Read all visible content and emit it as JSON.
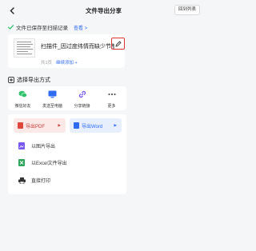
{
  "header": {
    "title": "文件导出分享",
    "return_label": "回到列表"
  },
  "saved": {
    "text": "文件已保存至扫描记录",
    "view_label": "查看 >"
  },
  "file": {
    "name": "扫描件_因过度纬情而缺少节制",
    "pages": "共1页",
    "continue_add": "继续添加 +"
  },
  "export_section": {
    "title": "选择导出方式"
  },
  "share": {
    "items": [
      {
        "label": "微信好友",
        "icon": "wechat-icon",
        "color": "#2ec26a"
      },
      {
        "label": "发送至电脑",
        "icon": "computer-icon",
        "color": "#2e6bf0"
      },
      {
        "label": "分享链接",
        "icon": "link-icon",
        "color": "#7b5af0"
      },
      {
        "label": "更多",
        "icon": "more-icon",
        "color": "#555555"
      }
    ]
  },
  "export": {
    "pdf_label": "导出PDF",
    "word_label": "导出Word",
    "options": [
      {
        "label": "以图片导出",
        "icon": "image-icon",
        "color": "#7b5af0"
      },
      {
        "label": "以Excel文件导出",
        "icon": "excel-icon",
        "color": "#2ea55b"
      },
      {
        "label": "直接打印",
        "icon": "printer-icon",
        "color": "#333333"
      }
    ]
  }
}
